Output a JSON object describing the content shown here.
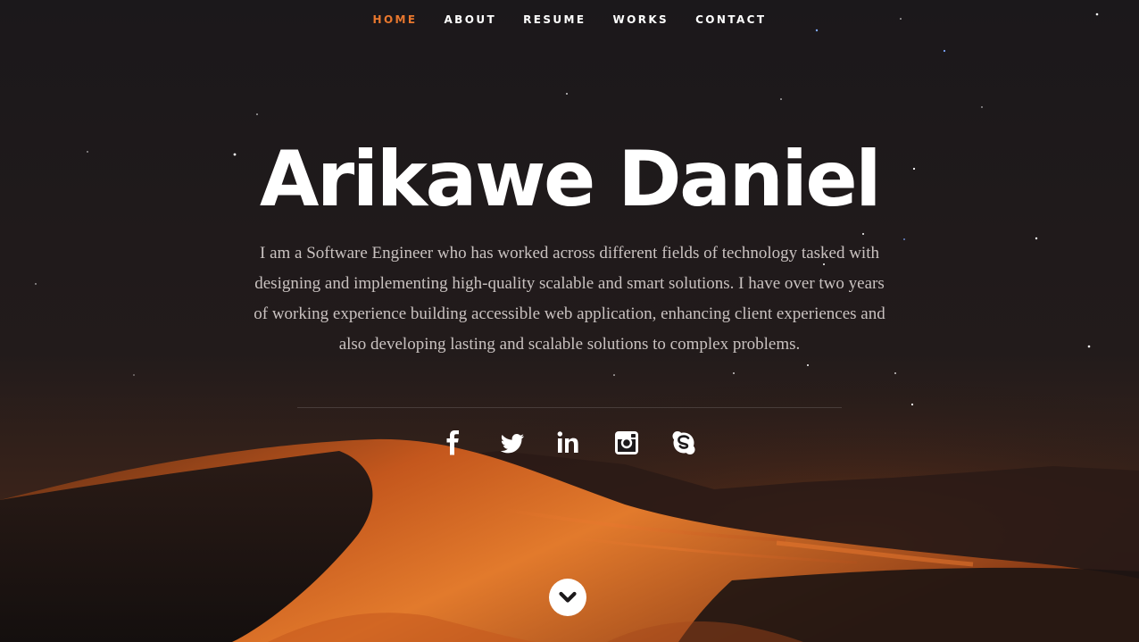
{
  "nav": {
    "items": [
      {
        "label": "HOME",
        "active": true
      },
      {
        "label": "ABOUT",
        "active": false
      },
      {
        "label": "RESUME",
        "active": false
      },
      {
        "label": "WORKS",
        "active": false
      },
      {
        "label": "CONTACT",
        "active": false
      }
    ],
    "active_color": "#e8772e"
  },
  "hero": {
    "name": "Arikawe Daniel",
    "bio": "I am a Software Engineer who has worked across different fields of technology tasked with designing and implementing high-quality scalable and smart solutions. I have over two years of working experience building accessible web application, enhancing client experiences and also developing lasting and scalable solutions to complex problems."
  },
  "social": {
    "icons": [
      "facebook-icon",
      "twitter-icon",
      "linkedin-icon",
      "instagram-icon",
      "skype-icon"
    ]
  },
  "scroll": {
    "icon": "chevron-down-icon"
  },
  "colors": {
    "background": "#1c191b",
    "accent": "#e8772e",
    "text": "#ffffff",
    "bio_text": "#c9c2c0"
  }
}
